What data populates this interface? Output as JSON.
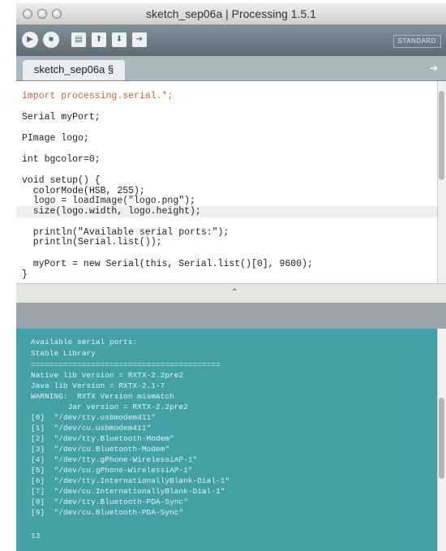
{
  "window": {
    "title": "sketch_sep06a | Processing 1.5.1"
  },
  "toolbar": {
    "run_icon": "play-icon",
    "stop_icon": "stop-icon",
    "new_icon": "new-document-icon",
    "open_icon": "arrow-up-icon",
    "save_icon": "arrow-down-icon",
    "export_icon": "export-arrow-icon",
    "mode_label": "STANDARD"
  },
  "tabs": {
    "items": [
      {
        "label": "sketch_sep06a §"
      }
    ],
    "arrow_icon": "arrow-right-icon"
  },
  "editor": {
    "lines": [
      "import processing.serial.*;",
      "Serial myPort;",
      "PImage logo;",
      "int bgcolor=0;",
      "void setup() {",
      "  colorMode(HSB, 255);",
      "  logo = loadImage(\"logo.png\");",
      "  size(logo.width, logo.height);",
      "  println(\"Available serial ports:\");",
      "  println(Serial.list());",
      "  myPort = new Serial(this, Serial.list()[0], 9600);",
      "}"
    ]
  },
  "console": {
    "lines": [
      "Available serial ports:",
      "Stable Library",
      "=========================================",
      "Native lib Version = RXTX-2.2pre2",
      "Java lib Version = RXTX-2.1-7",
      "WARNING:  RXTX Version mismatch",
      "        Jar version = RXTX-2.2pre2",
      "[0]  \"/dev/tty.usbmodem411\"",
      "[1]  \"/dev/cu.usbmodem411\"",
      "[2]  \"/dev/tty.Bluetooth-Modem\"",
      "[3]  \"/dev/cu.Bluetooth-Modem\"",
      "[4]  \"/dev/tty.gPhone-WirelessiAP-1\"",
      "[5]  \"/dev/cu.gPhone-WirelessiAP-1\"",
      "[6]  \"/dev/tty.InternationallyBlank-Dial-1\"",
      "[7]  \"/dev/cu.InternationallyBlank-Dial-1\"",
      "[8]  \"/dev/tty.Bluetooth-PDA-Sync\"",
      "[9]  \"/dev/cu.Bluetooth-PDA-Sync\"",
      "13"
    ]
  },
  "colors": {
    "toolbar": "#6d7c86",
    "console_bg": "#43a0a6",
    "keyword": "#cc6633",
    "type": "#006699"
  }
}
